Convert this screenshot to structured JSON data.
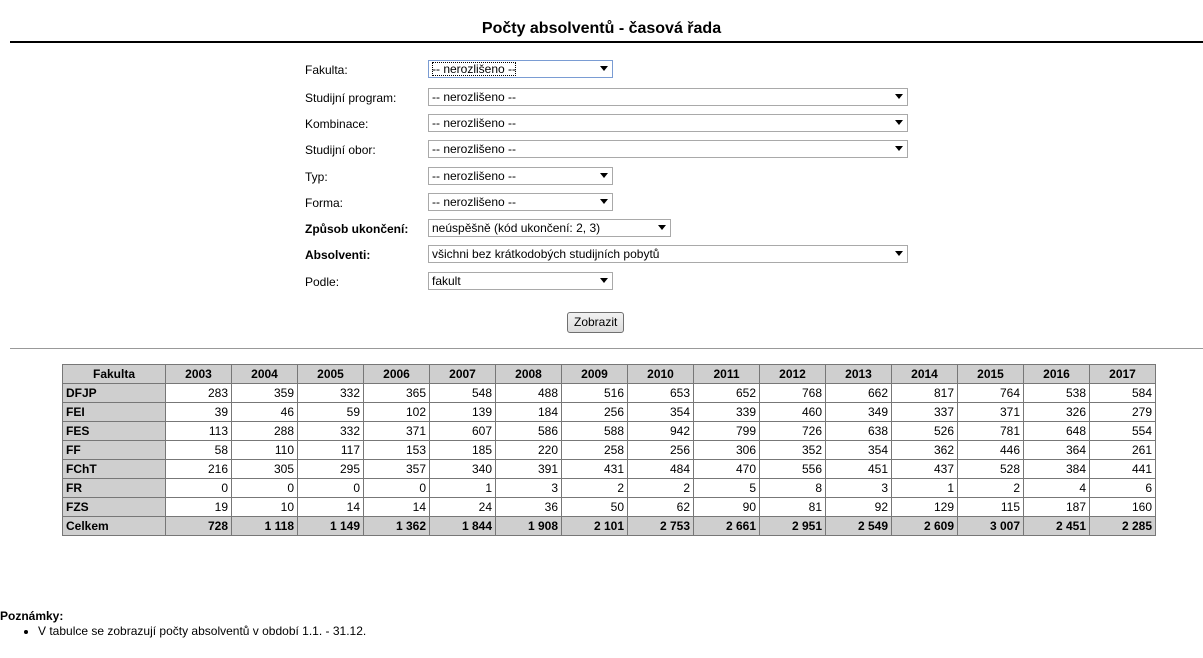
{
  "title": "Počty absolventů - časová řada",
  "form": {
    "fields": [
      {
        "label": "Fakulta:",
        "value": "-- nerozlišeno --",
        "bold": false
      },
      {
        "label": "Studijní program:",
        "value": "-- nerozlišeno --",
        "bold": false
      },
      {
        "label": "Kombinace:",
        "value": "-- nerozlišeno --",
        "bold": false
      },
      {
        "label": "Studijní obor:",
        "value": "-- nerozlišeno --",
        "bold": false
      },
      {
        "label": "Typ:",
        "value": "-- nerozlišeno --",
        "bold": false
      },
      {
        "label": "Forma:",
        "value": "-- nerozlišeno --",
        "bold": false
      },
      {
        "label": "Způsob ukončení:",
        "value": "neúspěšně (kód ukončení: 2, 3)",
        "bold": true
      },
      {
        "label": "Absolventi:",
        "value": "všichni bez krátkodobých studijních pobytů",
        "bold": true
      },
      {
        "label": "Podle:",
        "value": "fakult",
        "bold": false
      }
    ],
    "submit_label": "Zobrazit"
  },
  "table": {
    "headers": [
      "Fakulta",
      "2003",
      "2004",
      "2005",
      "2006",
      "2007",
      "2008",
      "2009",
      "2010",
      "2011",
      "2012",
      "2013",
      "2014",
      "2015",
      "2016",
      "2017"
    ],
    "rows": [
      {
        "name": "DFJP",
        "values": [
          "283",
          "359",
          "332",
          "365",
          "548",
          "488",
          "516",
          "653",
          "652",
          "768",
          "662",
          "817",
          "764",
          "538",
          "584"
        ]
      },
      {
        "name": "FEI",
        "values": [
          "39",
          "46",
          "59",
          "102",
          "139",
          "184",
          "256",
          "354",
          "339",
          "460",
          "349",
          "337",
          "371",
          "326",
          "279"
        ]
      },
      {
        "name": "FES",
        "values": [
          "113",
          "288",
          "332",
          "371",
          "607",
          "586",
          "588",
          "942",
          "799",
          "726",
          "638",
          "526",
          "781",
          "648",
          "554"
        ]
      },
      {
        "name": "FF",
        "values": [
          "58",
          "110",
          "117",
          "153",
          "185",
          "220",
          "258",
          "256",
          "306",
          "352",
          "354",
          "362",
          "446",
          "364",
          "261"
        ]
      },
      {
        "name": "FChT",
        "values": [
          "216",
          "305",
          "295",
          "357",
          "340",
          "391",
          "431",
          "484",
          "470",
          "556",
          "451",
          "437",
          "528",
          "384",
          "441"
        ]
      },
      {
        "name": "FR",
        "values": [
          "0",
          "0",
          "0",
          "0",
          "1",
          "3",
          "2",
          "2",
          "5",
          "8",
          "3",
          "1",
          "2",
          "4",
          "6"
        ]
      },
      {
        "name": "FZS",
        "values": [
          "19",
          "10",
          "14",
          "14",
          "24",
          "36",
          "50",
          "62",
          "90",
          "81",
          "92",
          "129",
          "115",
          "187",
          "160"
        ]
      }
    ],
    "total": {
      "name": "Celkem",
      "values": [
        "728",
        "1 118",
        "1 149",
        "1 362",
        "1 844",
        "1 908",
        "2 101",
        "2 753",
        "2 661",
        "2 951",
        "2 549",
        "2 609",
        "3 007",
        "2 451",
        "2 285"
      ]
    }
  },
  "notes": {
    "heading": "Poznámky:",
    "items": [
      "V tabulce se zobrazují počty absolventů v období 1.1. - 31.12."
    ]
  }
}
